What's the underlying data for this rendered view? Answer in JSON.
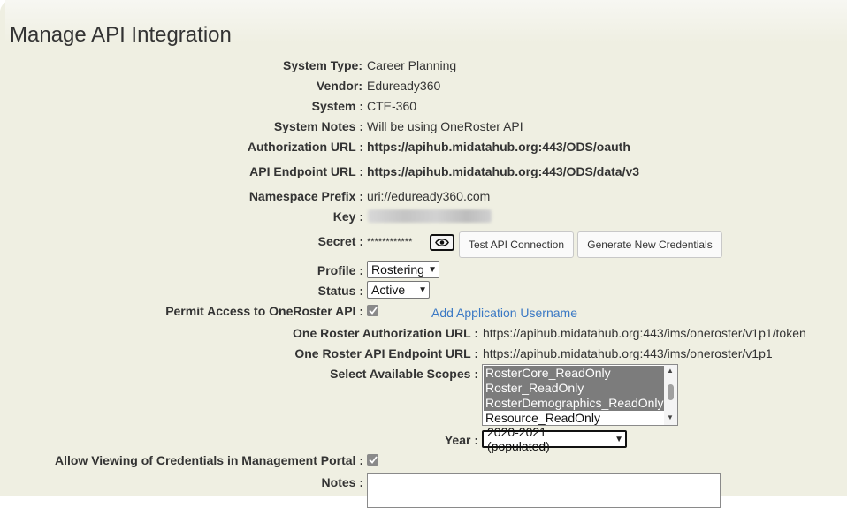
{
  "title": "Manage API Integration",
  "fields": {
    "system_type": {
      "label": "System Type:",
      "value": "Career Planning"
    },
    "vendor": {
      "label": "Vendor:",
      "value": "Eduready360"
    },
    "system": {
      "label": "System :",
      "value": "CTE-360"
    },
    "system_notes": {
      "label": "System Notes :",
      "value": "Will be using OneRoster API"
    },
    "authorization_url": {
      "label": "Authorization URL :",
      "value": "https://apihub.midatahub.org:443/ODS/oauth"
    },
    "api_endpoint_url": {
      "label": "API Endpoint URL :",
      "value": "https://apihub.midatahub.org:443/ODS/data/v3"
    },
    "namespace_prefix": {
      "label": "Namespace Prefix :",
      "value": "uri://eduready360.com"
    },
    "key": {
      "label": "Key :"
    },
    "secret": {
      "label": "Secret :",
      "value": "************"
    },
    "profile": {
      "label": "Profile :",
      "value": "Rostering"
    },
    "status": {
      "label": "Status :",
      "value": "Active"
    },
    "permit_access": {
      "label": "Permit Access to OneRoster API :",
      "checked": true
    },
    "oneroster_auth_url": {
      "label": "One Roster Authorization URL :",
      "value": "https://apihub.midatahub.org:443/ims/oneroster/v1p1/token"
    },
    "oneroster_endpoint_url": {
      "label": "One Roster API Endpoint URL :",
      "value": "https://apihub.midatahub.org:443/ims/oneroster/v1p1"
    },
    "scopes": {
      "label": "Select Available Scopes :",
      "options": [
        {
          "label": "RosterCore_ReadOnly",
          "selected": true
        },
        {
          "label": "Roster_ReadOnly",
          "selected": true
        },
        {
          "label": "RosterDemographics_ReadOnly",
          "selected": true
        },
        {
          "label": "Resource_ReadOnly",
          "selected": false
        }
      ]
    },
    "year": {
      "label": "Year :",
      "value": "2020-2021 (populated)"
    },
    "allow_viewing": {
      "label": "Allow Viewing of Credentials in Management Portal :",
      "checked": true
    },
    "notes": {
      "label": "Notes :",
      "value": ""
    }
  },
  "buttons": {
    "test_api": "Test API Connection",
    "generate_credentials": "Generate New Credentials"
  },
  "links": {
    "add_application_username": "Add Application Username"
  },
  "icons": {
    "reveal_secret": "eye-icon",
    "checkbox_check": "checkmark-icon",
    "dropdown": "chevron-down-icon"
  },
  "colors": {
    "panel_background": "#efefe2",
    "link": "#3a78c4",
    "selected_option": "#7c7c7c"
  }
}
